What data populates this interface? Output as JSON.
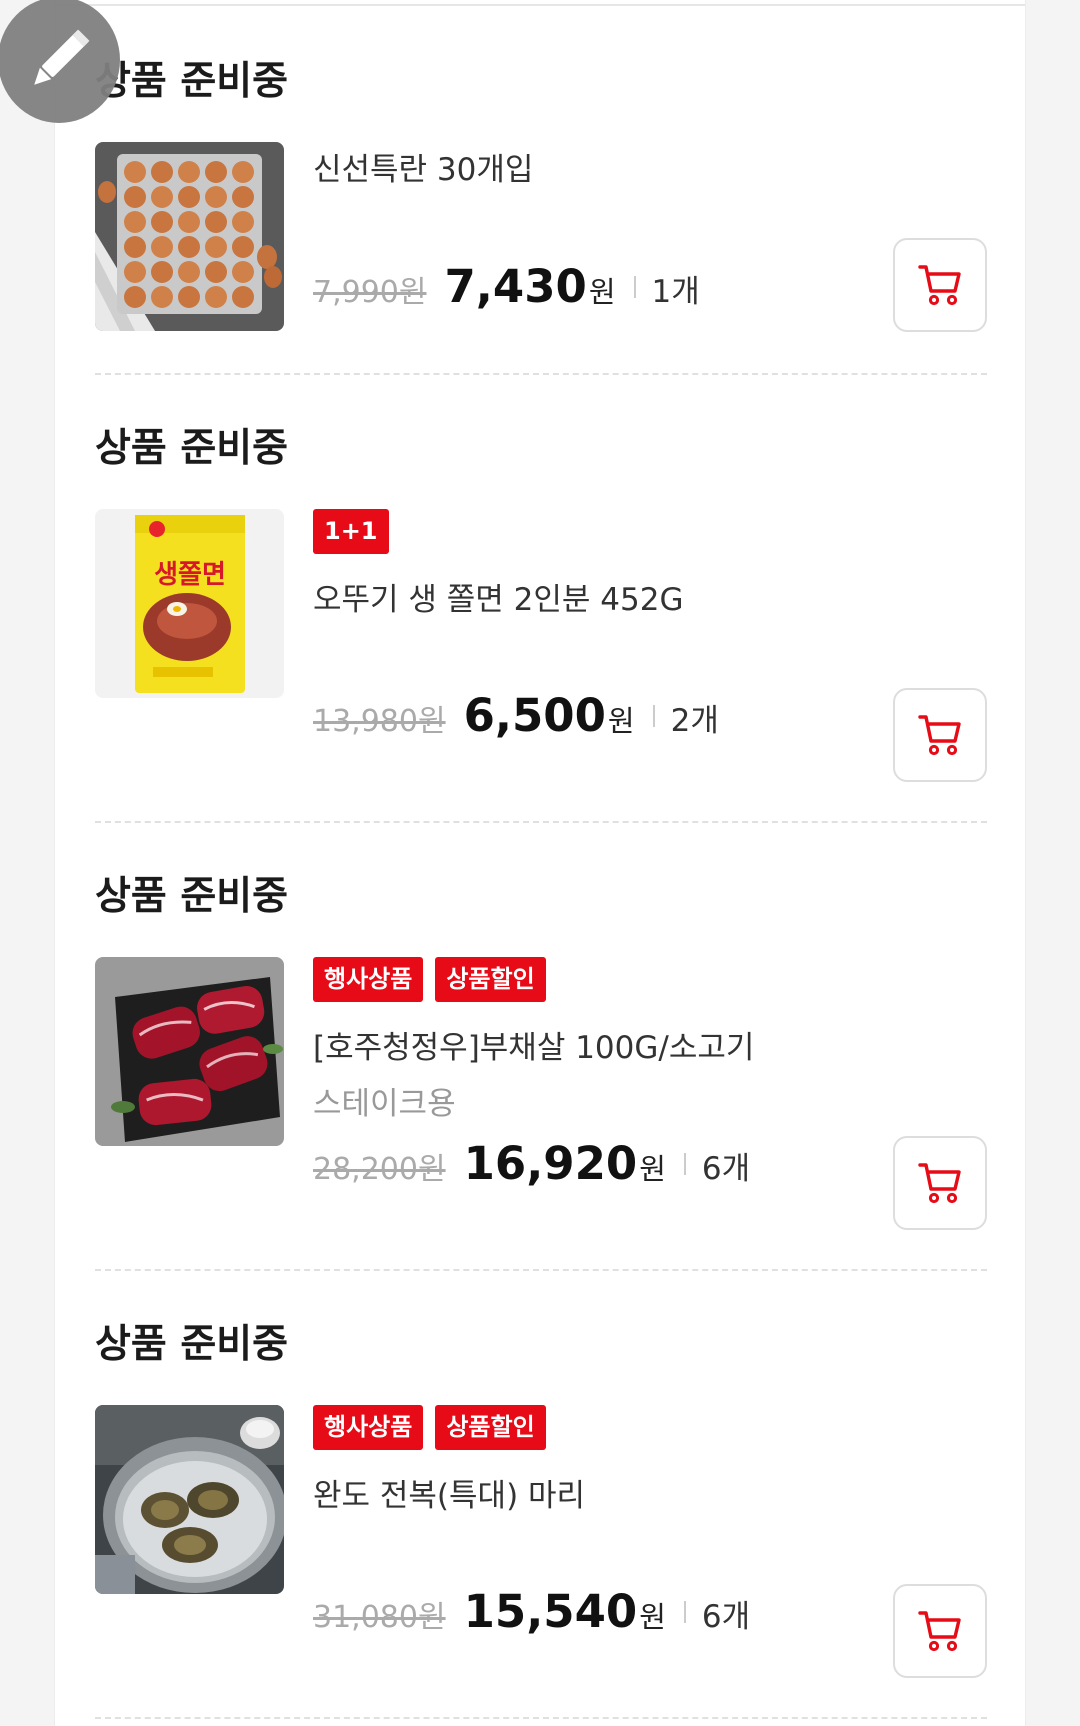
{
  "colors": {
    "accent": "#e60b17",
    "strike_price": "#aaaaaa",
    "fab": "#808080"
  },
  "edit_fab": {
    "icon": "pencil-icon"
  },
  "items": [
    {
      "status": "상품 준비중",
      "badges": [],
      "name_lines": [
        "신선특란 30개입"
      ],
      "original_price": "7,990원",
      "sale_price": "7,430",
      "currency": "원",
      "quantity": "1개",
      "image": "eggs-tray",
      "cart_icon": "cart-icon"
    },
    {
      "status": "상품 준비중",
      "badges": [
        "1+1"
      ],
      "name_lines": [
        "오뚜기 생 쫄면 2인분 452G"
      ],
      "original_price": "13,980원",
      "sale_price": "6,500",
      "currency": "원",
      "quantity": "2개",
      "image": "noodle-package",
      "package_text": "생쫄면",
      "cart_icon": "cart-icon"
    },
    {
      "status": "상품 준비중",
      "badges": [
        "행사상품",
        "상품할인"
      ],
      "name_lines": [
        "[호주청정우]부채살 100G/소고기",
        "스테이크용"
      ],
      "original_price": "28,200원",
      "sale_price": "16,920",
      "currency": "원",
      "quantity": "6개",
      "image": "beef-steak",
      "cart_icon": "cart-icon"
    },
    {
      "status": "상품 준비중",
      "badges": [
        "행사상품",
        "상품할인"
      ],
      "name_lines": [
        "완도 전복(특대) 마리"
      ],
      "original_price": "31,080원",
      "sale_price": "15,540",
      "currency": "원",
      "quantity": "6개",
      "image": "abalone-bowl",
      "cart_icon": "cart-icon"
    }
  ]
}
